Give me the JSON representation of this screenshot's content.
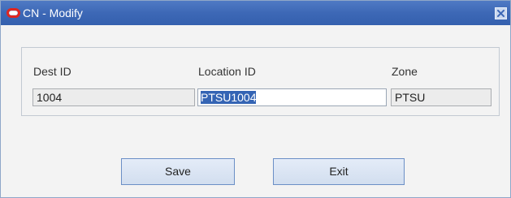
{
  "window": {
    "title": "CN - Modify",
    "logo_icon": "oracle-logo-icon",
    "close_icon": "close-x-icon"
  },
  "form": {
    "dest_id": {
      "label": "Dest ID",
      "value": "1004"
    },
    "location_id": {
      "label": "Location ID",
      "value": "PTSU1004"
    },
    "zone": {
      "label": "Zone",
      "value": "PTSU"
    }
  },
  "buttons": {
    "save_label": "Save",
    "exit_label": "Exit"
  },
  "colors": {
    "titlebar": "#3d68b6",
    "selection": "#3464b4",
    "logo": "#e0261f"
  }
}
